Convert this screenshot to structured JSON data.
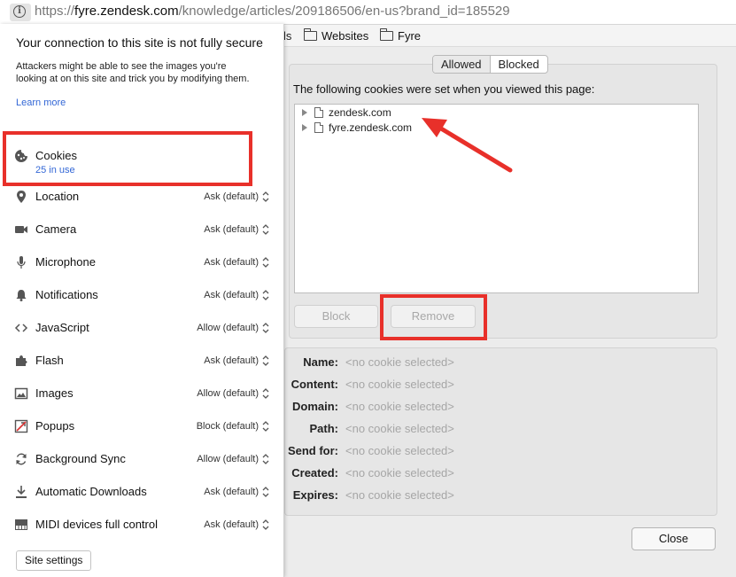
{
  "addressbar": {
    "scheme": "https://",
    "host": "fyre.zendesk.com",
    "path": "/knowledge/articles/209186506/en-us?brand_id=185529",
    "info_icon": "info-icon"
  },
  "bookmarks": {
    "cut_off_text": "ls",
    "items": [
      {
        "label": "Websites",
        "icon": "folder-icon"
      },
      {
        "label": "Fyre",
        "icon": "folder-icon"
      }
    ]
  },
  "popup": {
    "title": "Your connection to this site is not fully secure",
    "description": "Attackers might be able to see the images you're looking at on this site and trick you by modifying them.",
    "learn_more": "Learn more",
    "cookies": {
      "label": "Cookies",
      "sub": "25 in use",
      "icon": "cookie-icon"
    },
    "permissions": [
      {
        "label": "Location",
        "value": "Ask (default)",
        "icon": "location-icon"
      },
      {
        "label": "Camera",
        "value": "Ask (default)",
        "icon": "camera-icon"
      },
      {
        "label": "Microphone",
        "value": "Ask (default)",
        "icon": "microphone-icon"
      },
      {
        "label": "Notifications",
        "value": "Ask (default)",
        "icon": "bell-icon"
      },
      {
        "label": "JavaScript",
        "value": "Allow (default)",
        "icon": "code-icon"
      },
      {
        "label": "Flash",
        "value": "Ask (default)",
        "icon": "puzzle-icon"
      },
      {
        "label": "Images",
        "value": "Allow (default)",
        "icon": "image-icon"
      },
      {
        "label": "Popups",
        "value": "Block (default)",
        "icon": "popup-icon"
      },
      {
        "label": "Background Sync",
        "value": "Allow (default)",
        "icon": "sync-icon"
      },
      {
        "label": "Automatic Downloads",
        "value": "Ask (default)",
        "icon": "download-icon"
      },
      {
        "label": "MIDI devices full control",
        "value": "Ask (default)",
        "icon": "piano-icon"
      }
    ],
    "site_settings": "Site settings"
  },
  "dialog": {
    "tabs": {
      "allowed": "Allowed",
      "blocked": "Blocked",
      "selected": "Allowed"
    },
    "caption": "The following cookies were set when you viewed this page:",
    "tree": [
      "zendesk.com",
      "fyre.zendesk.com"
    ],
    "block_button": "Block",
    "remove_button": "Remove",
    "details": [
      {
        "label": "Name:",
        "value": "<no cookie selected>"
      },
      {
        "label": "Content:",
        "value": "<no cookie selected>"
      },
      {
        "label": "Domain:",
        "value": "<no cookie selected>"
      },
      {
        "label": "Path:",
        "value": "<no cookie selected>"
      },
      {
        "label": "Send for:",
        "value": "<no cookie selected>"
      },
      {
        "label": "Created:",
        "value": "<no cookie selected>"
      },
      {
        "label": "Expires:",
        "value": "<no cookie selected>"
      }
    ],
    "close_button": "Close"
  },
  "annotation_color": "#e8302a"
}
